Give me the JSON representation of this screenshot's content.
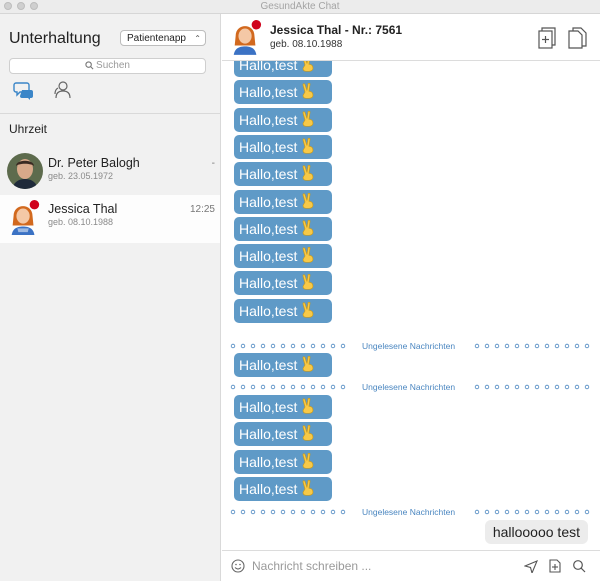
{
  "window": {
    "title": "GesundAkte Chat"
  },
  "sidebar": {
    "title": "Unterhaltung",
    "filter_selected": "Patientenapp",
    "search_placeholder": "Suchen",
    "section_label": "Uhrzeit",
    "contacts": [
      {
        "name": "Dr. Peter Balogh",
        "dob": "geb. 23.05.1972",
        "time": "-"
      },
      {
        "name": "Jessica Thal",
        "dob": "geb. 08.10.1988",
        "time": "12:25"
      }
    ]
  },
  "header": {
    "name": "Jessica Thal - Nr.: 7561",
    "dob": "geb. 08.10.1988"
  },
  "messages": {
    "incoming_text": "Hallo,test",
    "incoming_emoji": "victory-hand",
    "divider_label": "Ungelesene Nachrichten",
    "outgoing_text": "hallooooo test",
    "incoming_count_block1": 10,
    "incoming_count_block2": 1,
    "incoming_count_block3": 4
  },
  "composer": {
    "placeholder": "Nachricht schreiben ..."
  },
  "colors": {
    "incoming_bubble": "#5f9ac7",
    "divider_text": "#4a86c0",
    "sidebar_bg": "#f1f1f1",
    "outgoing_bubble": "#ececec"
  }
}
